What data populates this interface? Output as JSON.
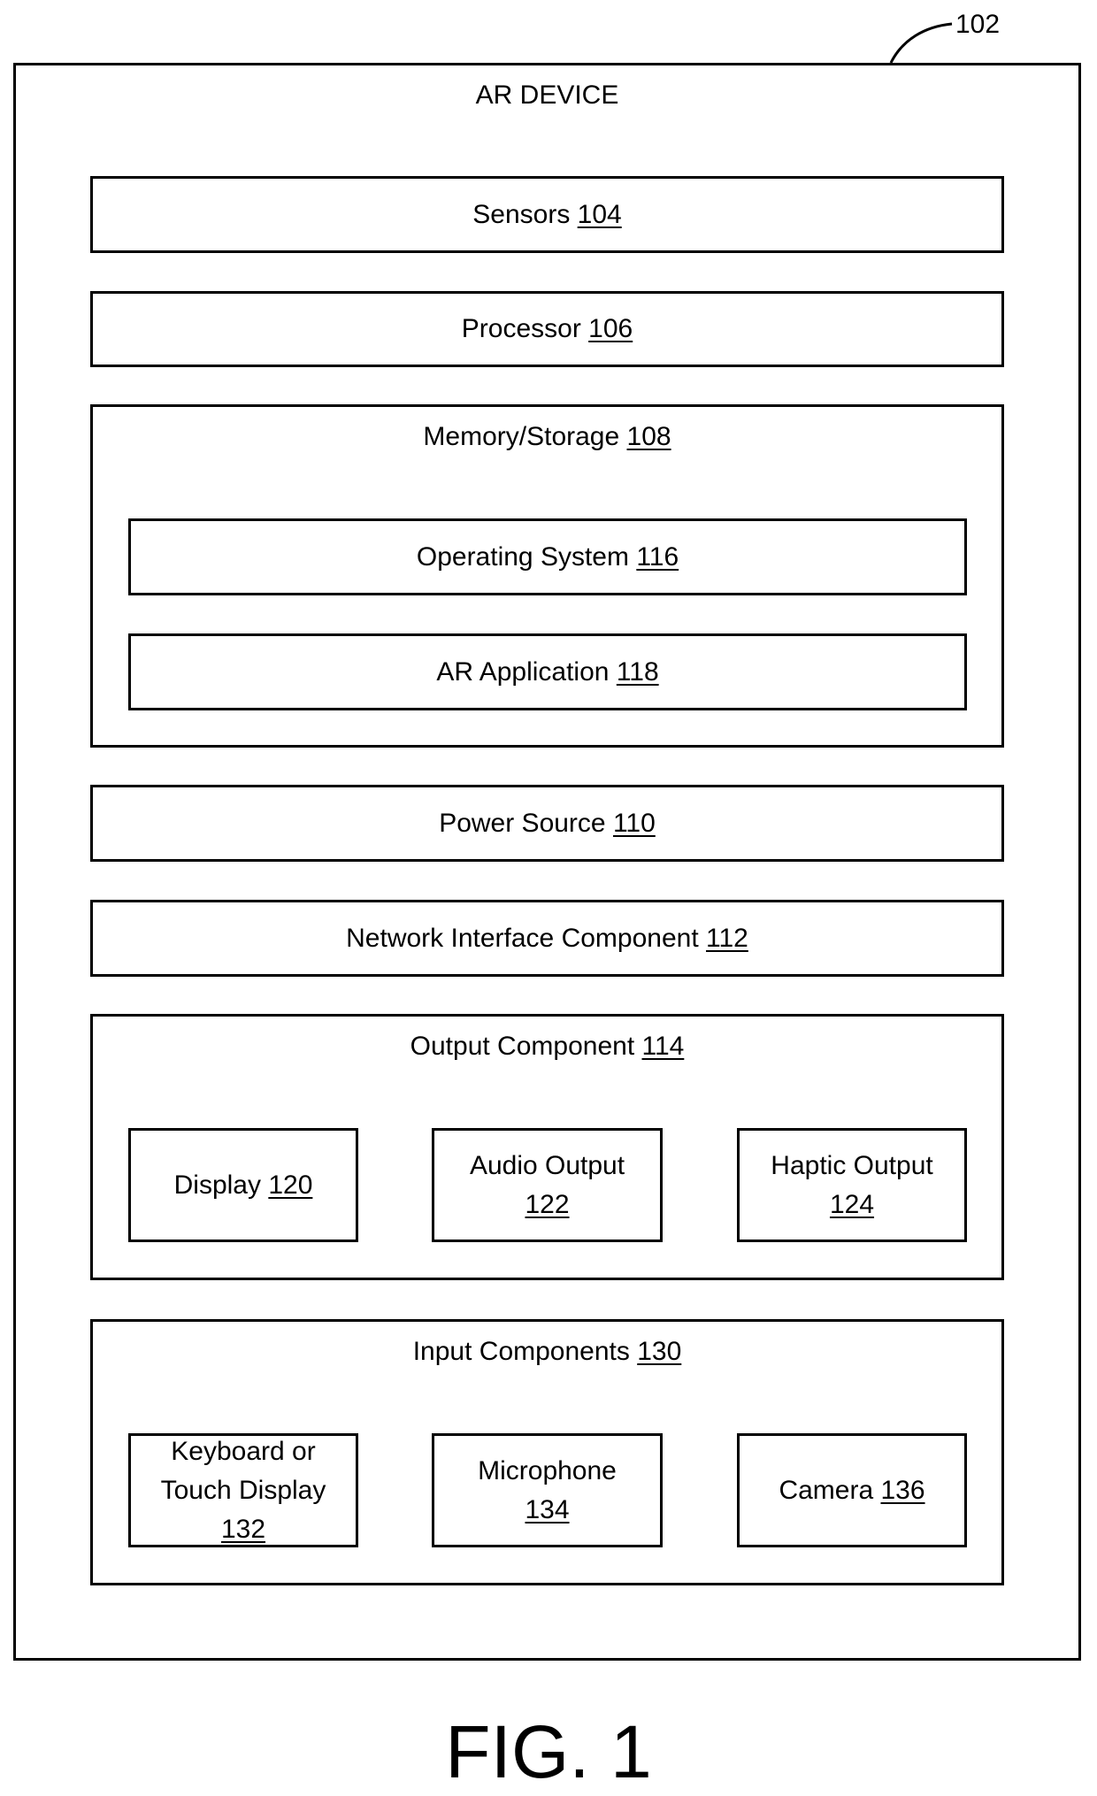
{
  "figure": {
    "caption": "FIG. 1",
    "device_ref": "102",
    "device_title": "AR DEVICE"
  },
  "blocks": {
    "sensors": {
      "label": "Sensors",
      "ref": "104"
    },
    "processor": {
      "label": "Processor",
      "ref": "106"
    },
    "memory": {
      "label": "Memory/Storage",
      "ref": "108",
      "children": {
        "os": {
          "label": "Operating System",
          "ref": "116"
        },
        "ar_app": {
          "label": "AR Application",
          "ref": "118"
        }
      }
    },
    "power": {
      "label": "Power Source",
      "ref": "110"
    },
    "network": {
      "label": "Network Interface Component",
      "ref": "112"
    },
    "output": {
      "label": "Output Component",
      "ref": "114",
      "children": {
        "display": {
          "label": "Display",
          "ref": "120"
        },
        "audio": {
          "label": "Audio Output",
          "ref": "122"
        },
        "haptic": {
          "label": "Haptic Output",
          "ref": "124"
        }
      }
    },
    "input": {
      "label": "Input Components",
      "ref": "130",
      "children": {
        "keyboard": {
          "line1": "Keyboard or",
          "line2": "Touch Display",
          "ref": "132"
        },
        "microphone": {
          "label": "Microphone",
          "ref": "134"
        },
        "camera": {
          "label": "Camera",
          "ref": "136"
        }
      }
    }
  }
}
